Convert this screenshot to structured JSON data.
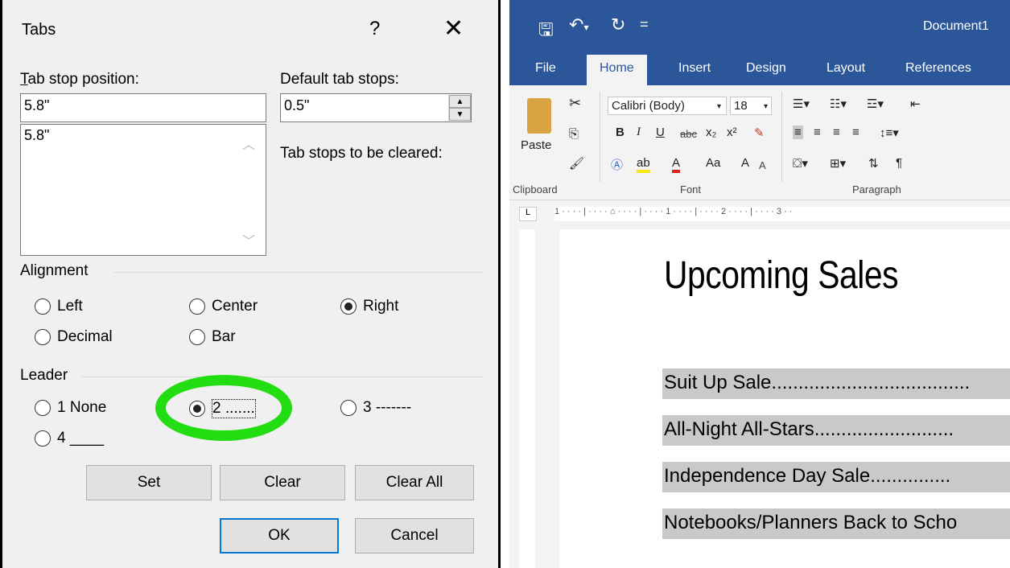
{
  "dialog": {
    "title": "Tabs",
    "help": "?",
    "close": "✕",
    "tab_stop_label": "Tab stop position:",
    "tab_stop_value": "5.8\"",
    "tab_stop_list": [
      "5.8\""
    ],
    "default_label": "Default tab stops:",
    "default_value": "0.5\"",
    "cleared_label": "Tab stops to be cleared:",
    "alignment": {
      "label": "Alignment",
      "options": [
        "Left",
        "Center",
        "Right",
        "Decimal",
        "Bar"
      ],
      "selected": "Right"
    },
    "leader": {
      "label": "Leader",
      "options": [
        "1 None",
        "2 .......",
        "3 -------",
        "4 ____"
      ],
      "selected": "2 ......."
    },
    "buttons": {
      "set": "Set",
      "clear": "Clear",
      "clear_all": "Clear All",
      "ok": "OK",
      "cancel": "Cancel"
    },
    "highlight_color": "#22dd11"
  },
  "word": {
    "doc_name": "Document1",
    "quick_access": {
      "save": "save-icon",
      "undo": "undo-icon",
      "redo": "redo-icon",
      "more": "="
    },
    "tabs": [
      "File",
      "Home",
      "Insert",
      "Design",
      "Layout",
      "References"
    ],
    "active_tab": "Home",
    "ribbon": {
      "paste": "Paste",
      "font_name": "Calibri (Body)",
      "font_size": "18",
      "bold": "B",
      "italic": "I",
      "underline": "U",
      "strike": "abc",
      "subscript": "x₂",
      "superscript": "x²",
      "case": "Aa",
      "grow": "A",
      "shrink": "A",
      "pilcrow": "¶",
      "groups": [
        "Clipboard",
        "Font",
        "Paragraph"
      ]
    },
    "ruler_marks": "1 · · · · | · · · · ⌂ · · · · | · · · · 1 · · · · | · · · · 2 · · · · | · · · · 3 · ·",
    "document": {
      "title": "Upcoming Sales",
      "lines": [
        "Suit Up Sale.....................................",
        "All-Night All-Stars..........................",
        "Independence Day Sale...............",
        "Notebooks/Planners Back to Scho"
      ]
    },
    "brand_color": "#2b579a"
  }
}
